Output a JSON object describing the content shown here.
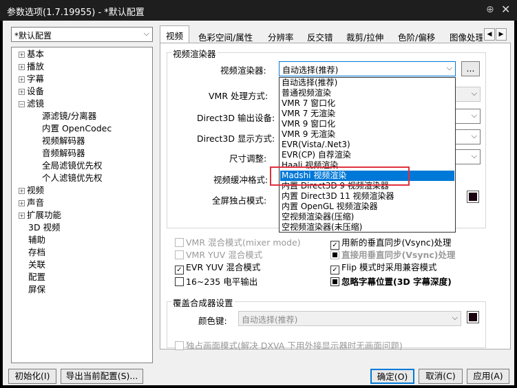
{
  "window": {
    "title": "参数选项(1.7.19955) - *默认配置",
    "pin_icon": "pin-icon",
    "close_icon": "close-icon"
  },
  "profile": {
    "value": "*默认配置"
  },
  "tree": {
    "items": [
      "基本",
      "播放",
      "字幕",
      "设备",
      "滤镜",
      "源滤镜/分离器",
      "内置 OpenCodec",
      "视频解码器",
      "音频解码器",
      "全局滤镜优先权",
      "个人滤镜优先权",
      "视频",
      "声音",
      "扩展功能",
      "3D 视频",
      "辅助",
      "存档",
      "关联",
      "配置",
      "屏保"
    ]
  },
  "tabs": [
    "视频",
    "色彩空间/属性",
    "分辨率",
    "反交错",
    "裁剪/拉伸",
    "色阶/偏移",
    "图像处理"
  ],
  "tab_nav": {
    "left": "◀",
    "right": "▶"
  },
  "renderer_group": {
    "title": "视频渲染器",
    "renderer_label": "视频渲染器:",
    "renderer_value": "自动选择(推荐)",
    "more_button": "...",
    "vmr_mode_label": "VMR 处理方式:",
    "d3d_device_label": "Direct3D 输出设备:",
    "d3d_display_label": "Direct3D 显示方式:",
    "size_label": "尺寸调整:",
    "buffer_label": "视频缓冲格式:",
    "exclusive_label": "全屏独占模式:"
  },
  "dropdown": {
    "options": [
      "自动选择(推荐)",
      "普通视频渲染",
      "VMR 7 窗口化",
      "VMR 7 无渲染",
      "VMR 9 窗口化",
      "VMR 9 无渲染",
      "EVR(Vista/.Net3)",
      "EVR(CP) 自荐渲染",
      "Haali 视频渲染",
      "Madshi 视频渲染",
      "内置 Direct3D 9 视频渲染器",
      "内置 Direct3D 11 视频渲染器",
      "内置 OpenGL 视频渲染器",
      "空视频渲染器(压缩)",
      "空视频渲染器(未压缩)"
    ],
    "selected_index": 9,
    "highlight_color": "#0078d7",
    "annotation_color": "#e0303c"
  },
  "options": {
    "vmr_mixer": "VMR 混合模式(mixer mode)",
    "vmr_yuv": "VMR YUV 混合模式",
    "evr_yuv": "EVR YUV 混合模式",
    "level_16_235": "16~235 电平输出",
    "new_vsync": "用新的垂直同步(Vsync)处理",
    "direct_vsync": "直接用垂直同步(Vsync)处理",
    "flip_mode": "Flip 模式时采用兼容模式",
    "ignore_subtitle": "忽略字幕位置(3D 字幕深度)"
  },
  "overlay_group": {
    "title": "覆盖合成器设置",
    "color_key_label": "颜色键:",
    "color_key_value": "自动选择(推荐)",
    "exclusive_display": "独占画面模式(解决 DXVA 下用外接显示器时无画面问题)"
  },
  "buttons": {
    "init": "初始化(I)",
    "export": "导出当前配置(S)...",
    "ok": "确定(O)",
    "cancel": "取消(C)",
    "apply": "应用(A)"
  }
}
